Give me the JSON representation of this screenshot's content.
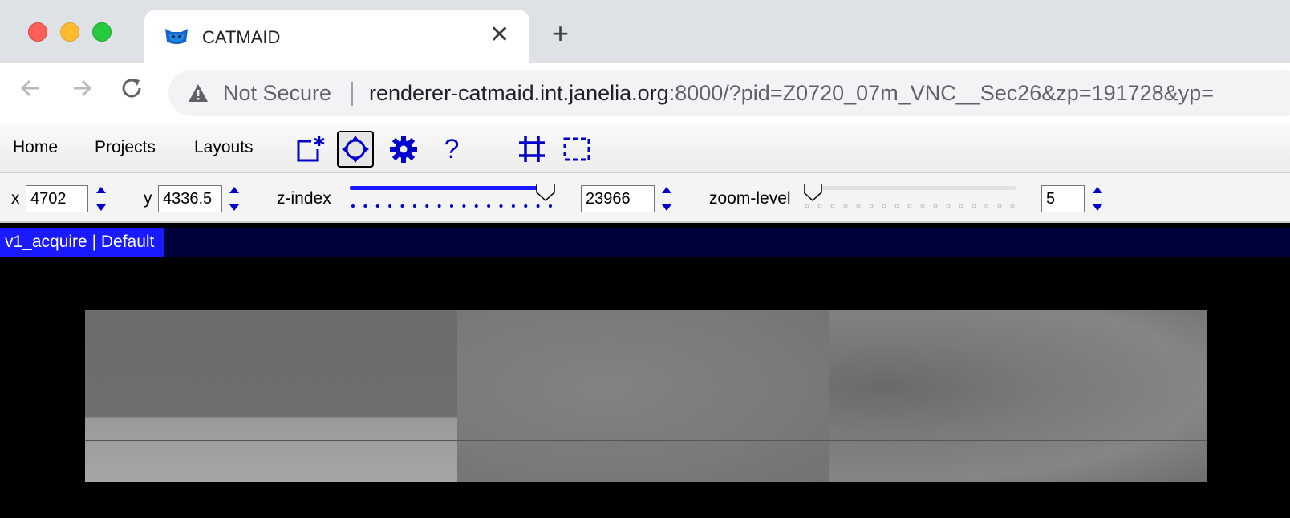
{
  "browser": {
    "tab_title": "CATMAID",
    "new_tab_symbol": "+",
    "close_symbol": "✕",
    "security_label": "Not Secure",
    "url_host": "renderer-catmaid.int.janelia.org",
    "url_rest": ":8000/?pid=Z0720_07m_VNC__Sec26&zp=191728&yp="
  },
  "menubar": {
    "items": [
      "Home",
      "Projects",
      "Layouts"
    ],
    "tools": [
      "new-window-icon",
      "navigate-icon",
      "settings-icon",
      "help-icon",
      "crop-icon",
      "roi-select-icon"
    ],
    "active_tool": "navigate-icon",
    "help_symbol": "?"
  },
  "navigation": {
    "x_label": "x",
    "x_value": "4702",
    "y_label": "y",
    "y_value": "4336.5",
    "z_label": "z-index",
    "z_value": "23966",
    "z_slider_fraction": 0.96,
    "zoom_label": "zoom-level",
    "zoom_value": "5",
    "zoom_slider_fraction": 0.0
  },
  "viewer": {
    "title": "v1_acquire | Default"
  },
  "colors": {
    "accent": "#1a1aff",
    "control_blue": "#0000cc",
    "viewer_title_bg": "#00003a"
  }
}
